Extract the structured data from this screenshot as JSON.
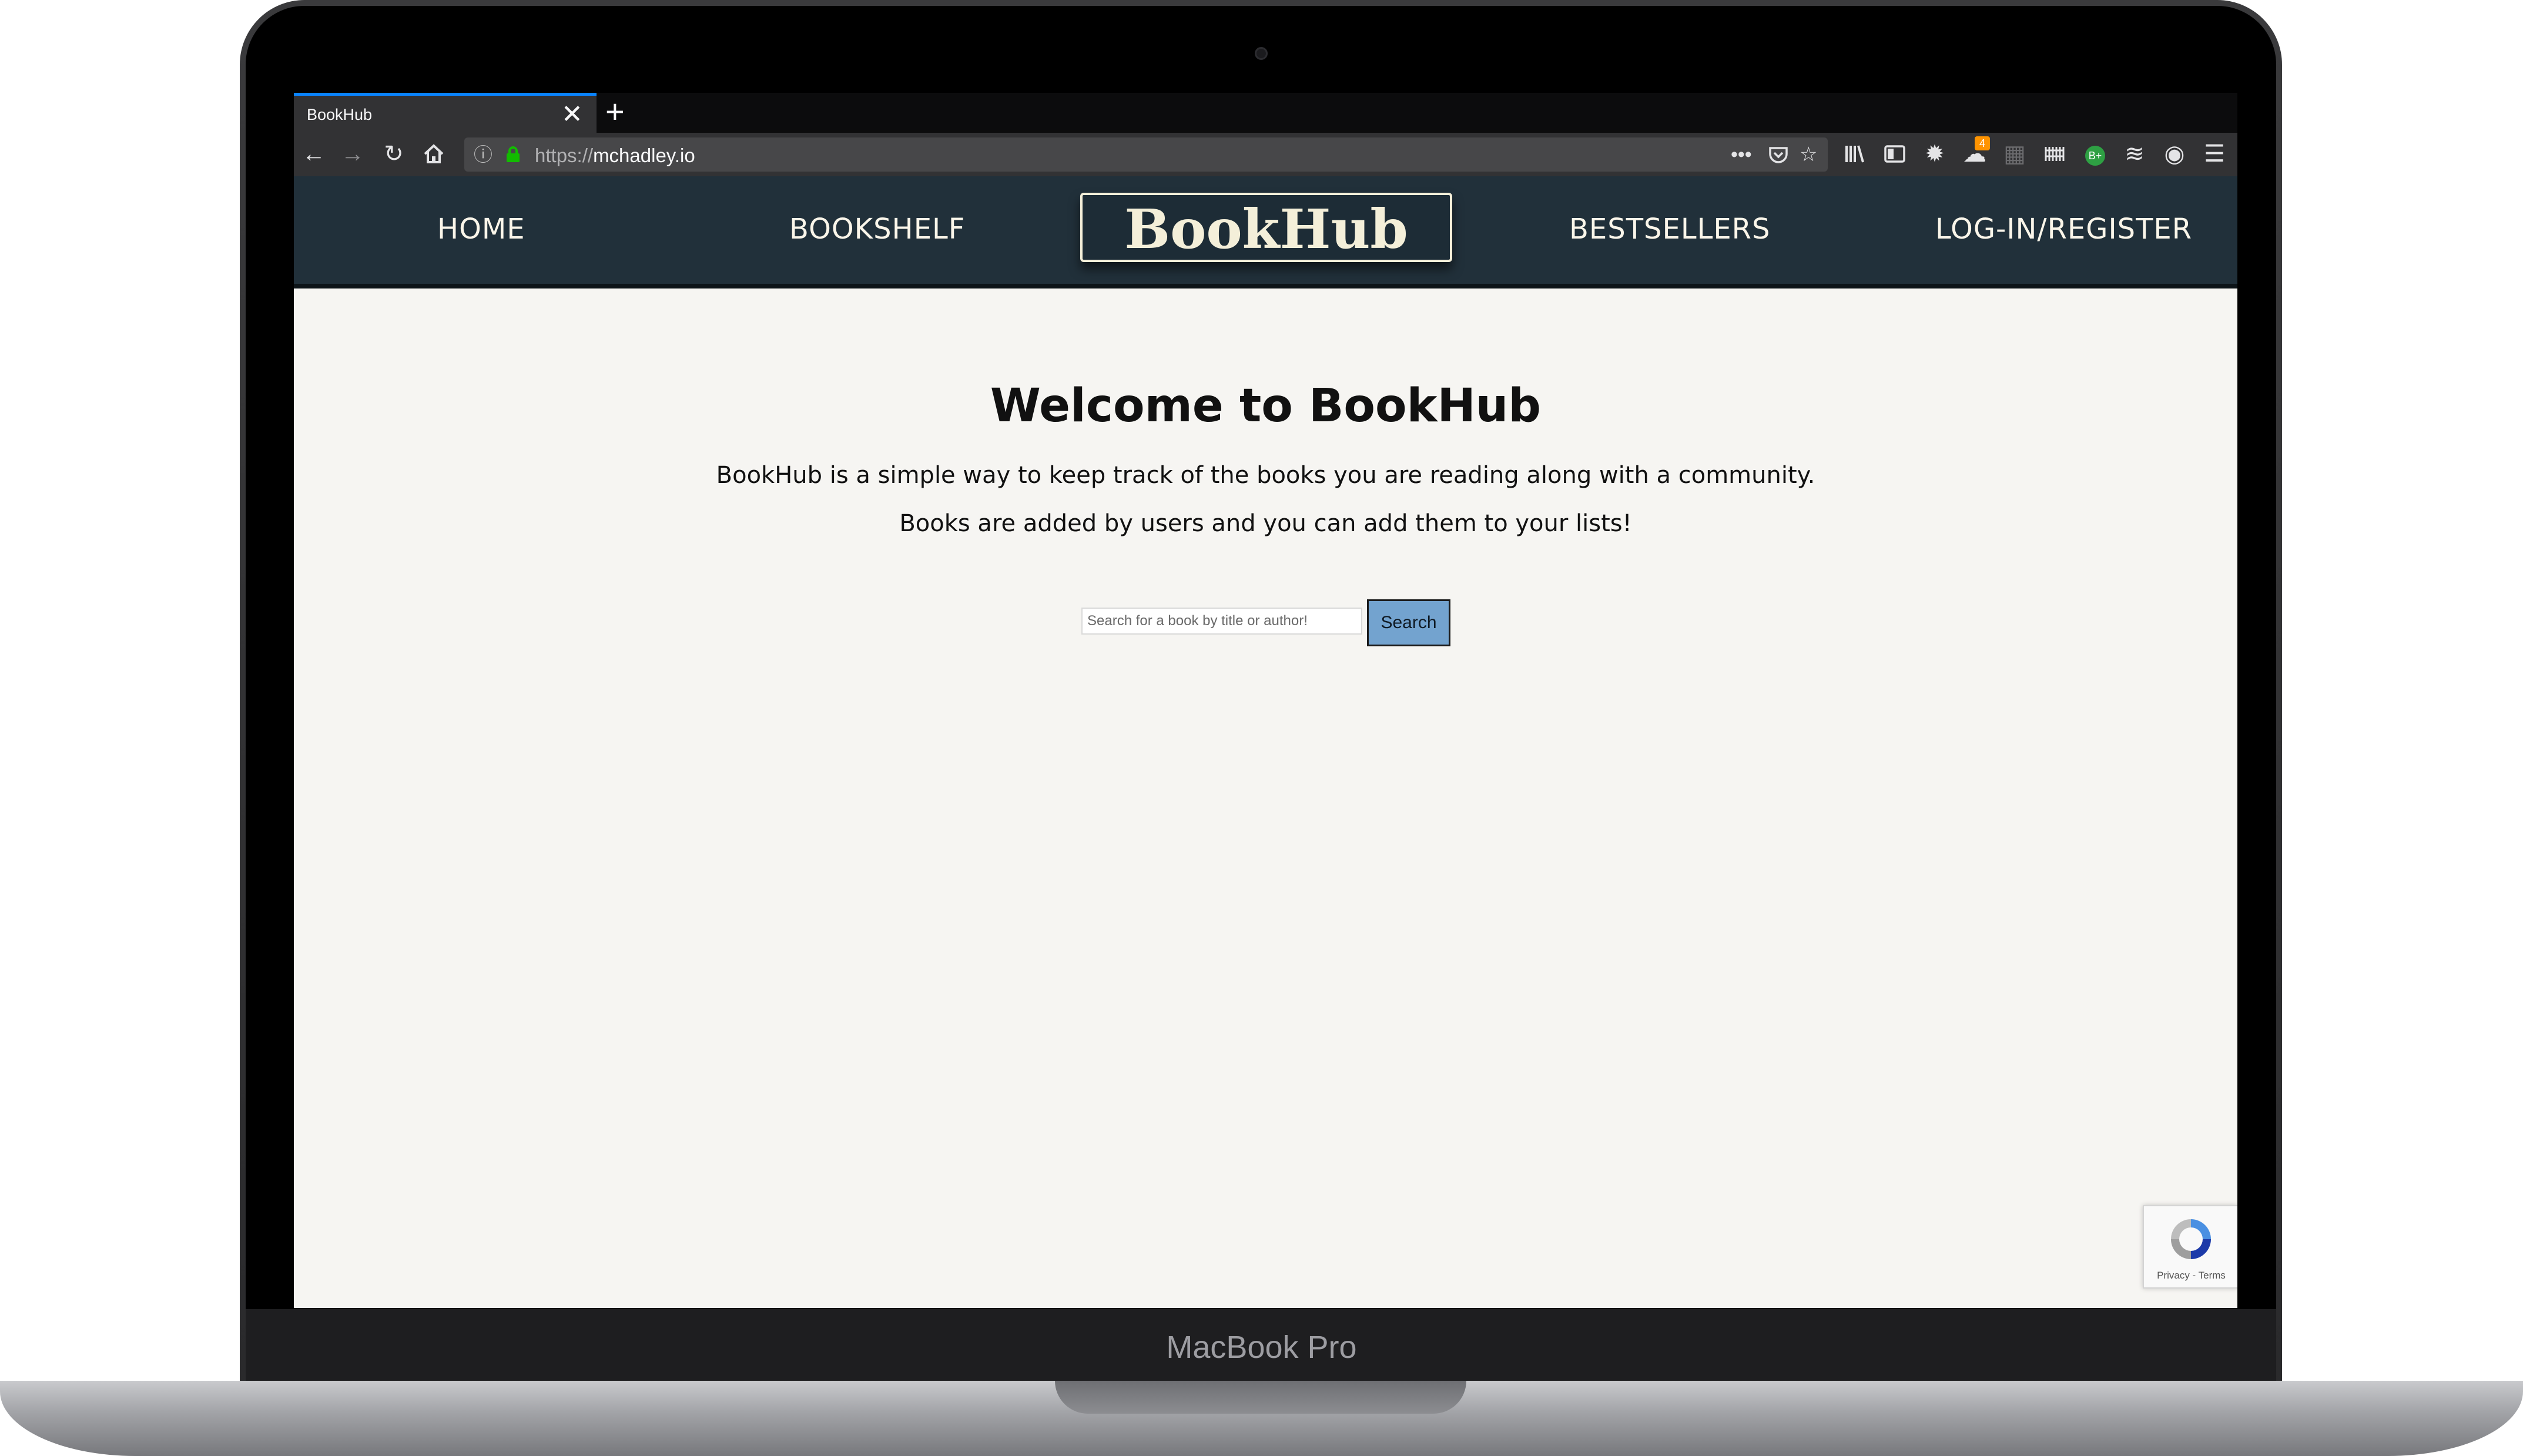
{
  "device": {
    "label": "MacBook Pro"
  },
  "browser": {
    "tab_title": "BookHub",
    "tab_close_glyph": "✕",
    "new_tab_glyph": "+",
    "url_scheme": "https://",
    "url_host": "mchadley.io",
    "extension_badge": "4",
    "green_badge": "B+",
    "icons": [
      "back-icon",
      "forward-icon",
      "reload-icon",
      "home-icon",
      "info-icon",
      "lock-icon",
      "page-actions-icon",
      "pocket-icon",
      "bookmark-star-icon",
      "library-icon",
      "sidebar-icon",
      "extension-icons",
      "menu-icon"
    ]
  },
  "site": {
    "nav": {
      "home": "HOME",
      "bookshelf": "BOOKSHELF",
      "logo": "BookHub",
      "bestsellers": "BESTSELLERS",
      "login": "LOG-IN/REGISTER"
    },
    "main": {
      "title": "Welcome to BookHub",
      "paragraph_1": "BookHub is a simple way to keep track of the books you are reading along with a community.",
      "paragraph_2": "Books are added by users and you can add them to your lists!",
      "search_placeholder": "Search for a book by title or author!",
      "search_value": "",
      "search_button": "Search"
    },
    "recaptcha": {
      "links": "Privacy - Terms"
    }
  },
  "colors": {
    "header_bg": "#21303a",
    "header_text": "#fbf6ea",
    "page_bg": "#f6f5f2",
    "search_button_bg": "#73a3cf",
    "tab_accent": "#0a84ff"
  }
}
